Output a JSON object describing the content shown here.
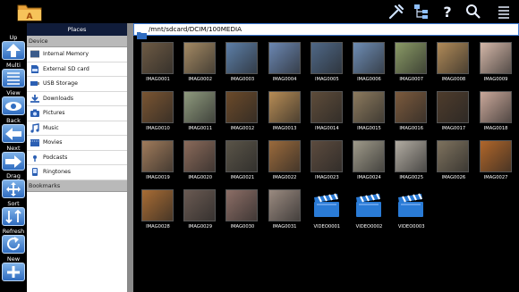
{
  "actionbar": {
    "icons": [
      "folder-app-icon",
      "tools-icon",
      "tree-icon",
      "help-icon",
      "search-icon",
      "menu-icon"
    ]
  },
  "tools": [
    {
      "label": "Up",
      "icon": "up-arrow-icon"
    },
    {
      "label": "Multi",
      "icon": "multi-select-icon"
    },
    {
      "label": "View",
      "icon": "eye-icon"
    },
    {
      "label": "Back",
      "icon": "back-arrow-icon"
    },
    {
      "label": "Next",
      "icon": "next-arrow-icon"
    },
    {
      "label": "Drag",
      "icon": "drag-icon"
    },
    {
      "label": "Sort",
      "icon": "sort-icon"
    },
    {
      "label": "Refresh",
      "icon": "refresh-icon"
    },
    {
      "label": "New",
      "icon": "plus-icon"
    }
  ],
  "places": {
    "title": "Places",
    "device_header": "Device",
    "items": [
      {
        "label": "Internal Memory",
        "icon": "memory-icon"
      },
      {
        "label": "External SD card",
        "icon": "sdcard-icon"
      },
      {
        "label": "USB Storage",
        "icon": "usb-icon"
      },
      {
        "label": "Downloads",
        "icon": "download-icon"
      },
      {
        "label": "Pictures",
        "icon": "camera-icon"
      },
      {
        "label": "Music",
        "icon": "music-icon"
      },
      {
        "label": "Movies",
        "icon": "film-icon"
      },
      {
        "label": "Podcasts",
        "icon": "podcast-icon"
      },
      {
        "label": "Ringtones",
        "icon": "ringtone-icon"
      }
    ],
    "bookmarks_header": "Bookmarks"
  },
  "path": "/mnt/sdcard/DCIM/100MEDIA",
  "files": [
    {
      "name": "IMAG0001",
      "type": "image",
      "color": "#6d5a44"
    },
    {
      "name": "IMAG0002",
      "type": "image",
      "color": "#a48a64"
    },
    {
      "name": "IMAG0003",
      "type": "image",
      "color": "#5d7fa8"
    },
    {
      "name": "IMAG0004",
      "type": "image",
      "color": "#6b87b2"
    },
    {
      "name": "IMAG0005",
      "type": "image",
      "color": "#4f6887"
    },
    {
      "name": "IMAG0006",
      "type": "image",
      "color": "#6e8db5"
    },
    {
      "name": "IMAG0007",
      "type": "image",
      "color": "#8a9a66"
    },
    {
      "name": "IMAG0008",
      "type": "image",
      "color": "#b08a58"
    },
    {
      "name": "IMAG0009",
      "type": "image",
      "color": "#d4b7a8"
    },
    {
      "name": "IMAG0010",
      "type": "image",
      "color": "#7a5532"
    },
    {
      "name": "IMAG0011",
      "type": "image",
      "color": "#8f9a7e"
    },
    {
      "name": "IMAG0012",
      "type": "image",
      "color": "#6b4a2a"
    },
    {
      "name": "IMAG0013",
      "type": "image",
      "color": "#b78c55"
    },
    {
      "name": "IMAG0014",
      "type": "image",
      "color": "#5e4c3a"
    },
    {
      "name": "IMAG0015",
      "type": "image",
      "color": "#8c7a5e"
    },
    {
      "name": "IMAG0016",
      "type": "image",
      "color": "#7b5a3d"
    },
    {
      "name": "IMAG0017",
      "type": "image",
      "color": "#4e3c2c"
    },
    {
      "name": "IMAG0018",
      "type": "image",
      "color": "#caa89a"
    },
    {
      "name": "IMAG0019",
      "type": "image",
      "color": "#a07b5b"
    },
    {
      "name": "IMAG0020",
      "type": "image",
      "color": "#8a6a5a"
    },
    {
      "name": "IMAG0021",
      "type": "image",
      "color": "#5a5448"
    },
    {
      "name": "IMAG0022",
      "type": "image",
      "color": "#9a6a3c"
    },
    {
      "name": "IMAG0023",
      "type": "image",
      "color": "#5c4b3e"
    },
    {
      "name": "IMAG0024",
      "type": "image",
      "color": "#9f9a8a"
    },
    {
      "name": "IMAG0025",
      "type": "image",
      "color": "#b2aca2"
    },
    {
      "name": "IMAG0026",
      "type": "image",
      "color": "#7e725e"
    },
    {
      "name": "IMAG0027",
      "type": "image",
      "color": "#b0662a"
    },
    {
      "name": "IMAG0028",
      "type": "image",
      "color": "#a86c34"
    },
    {
      "name": "IMAG0029",
      "type": "image",
      "color": "#6a5a52"
    },
    {
      "name": "IMAG0030",
      "type": "image",
      "color": "#8c6e66"
    },
    {
      "name": "IMAG0031",
      "type": "image",
      "color": "#9a8a80"
    },
    {
      "name": "VIDEO0001",
      "type": "video",
      "color": "#2a7bd6"
    },
    {
      "name": "VIDEO0002",
      "type": "video",
      "color": "#2a7bd6"
    },
    {
      "name": "VIDEO0003",
      "type": "video",
      "color": "#2a7bd6"
    }
  ]
}
